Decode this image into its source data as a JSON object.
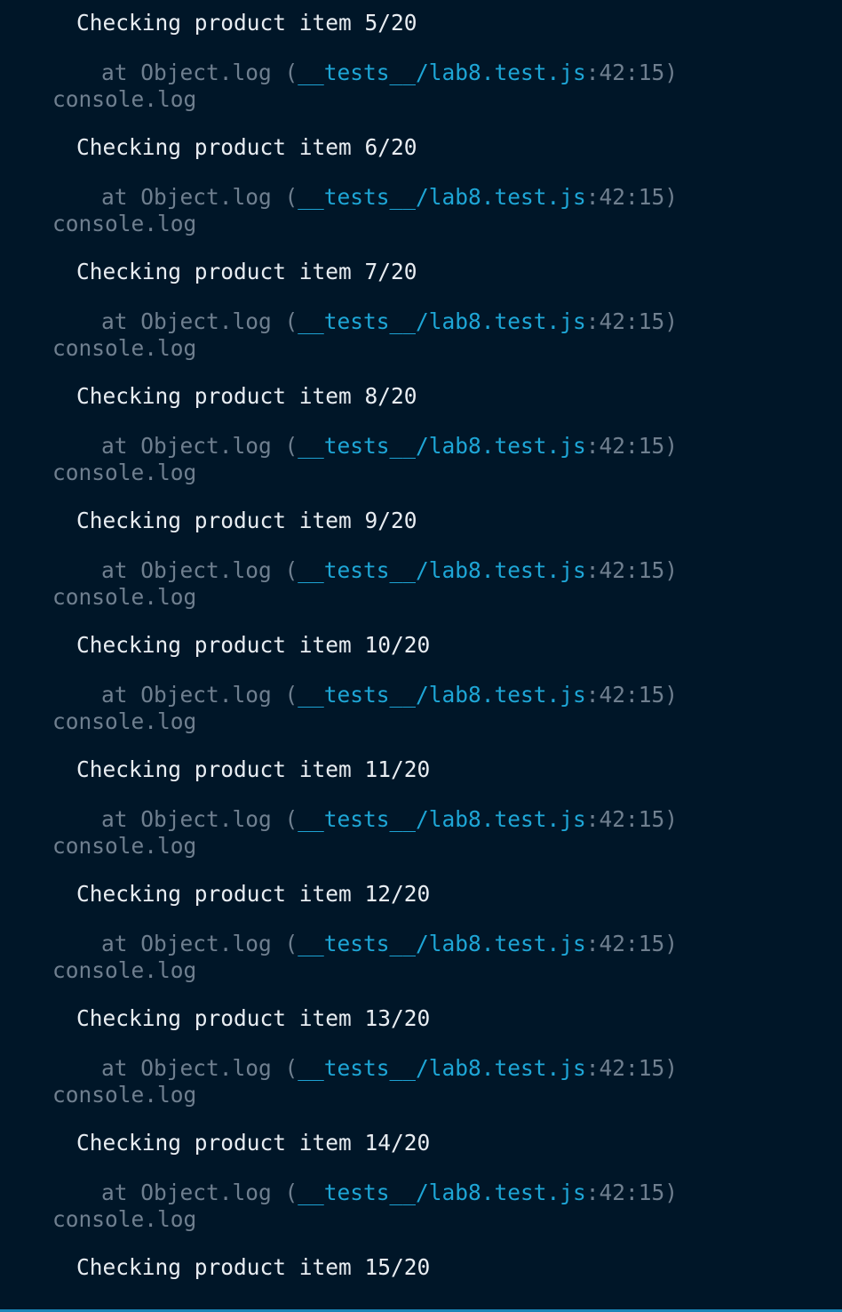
{
  "header_label": "console.log",
  "at_prefix": "at Object.log (",
  "file_path": "__tests__/lab8.test.js",
  "line_col": ":42:15)",
  "colors": {
    "background": "#001628",
    "message": "#e8edf2",
    "muted": "#6f7f8f",
    "path": "#1ea6d6"
  },
  "entries": [
    {
      "message": "Checking product item 5/20"
    },
    {
      "message": "Checking product item 6/20"
    },
    {
      "message": "Checking product item 7/20"
    },
    {
      "message": "Checking product item 8/20"
    },
    {
      "message": "Checking product item 9/20"
    },
    {
      "message": "Checking product item 10/20"
    },
    {
      "message": "Checking product item 11/20"
    },
    {
      "message": "Checking product item 12/20"
    },
    {
      "message": "Checking product item 13/20"
    },
    {
      "message": "Checking product item 14/20"
    },
    {
      "message": "Checking product item 15/20"
    }
  ]
}
